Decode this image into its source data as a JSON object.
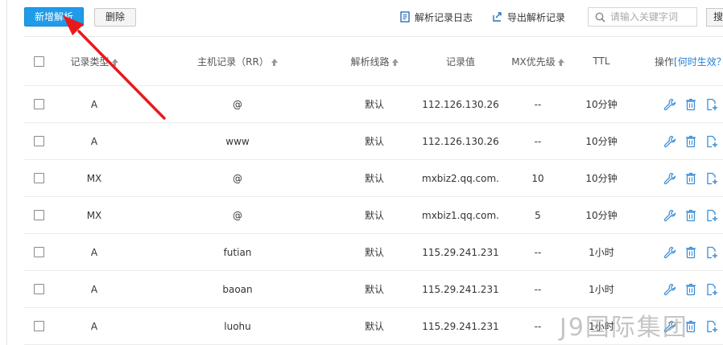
{
  "toolbar": {
    "add_label": "新增解析",
    "delete_label": "删除",
    "log_label": "解析记录日志",
    "export_label": "导出解析记录",
    "search_placeholder": "请输入关键字词",
    "search_btn": "搜"
  },
  "table": {
    "headers": {
      "type": "记录类型",
      "host": "主机记录（RR）",
      "line": "解析线路",
      "value": "记录值",
      "mx": "MX优先级",
      "ttl": "TTL",
      "ops": "操作",
      "ops_link": "[何时生效？"
    },
    "rows": [
      {
        "type": "A",
        "host": "@",
        "line": "默认",
        "value": "112.126.130.26",
        "mx": "--",
        "ttl": "10分钟"
      },
      {
        "type": "A",
        "host": "www",
        "line": "默认",
        "value": "112.126.130.26",
        "mx": "--",
        "ttl": "10分钟"
      },
      {
        "type": "MX",
        "host": "@",
        "line": "默认",
        "value": "mxbiz2.qq.com.",
        "mx": "10",
        "ttl": "10分钟"
      },
      {
        "type": "MX",
        "host": "@",
        "line": "默认",
        "value": "mxbiz1.qq.com.",
        "mx": "5",
        "ttl": "10分钟"
      },
      {
        "type": "A",
        "host": "futian",
        "line": "默认",
        "value": "115.29.241.231",
        "mx": "--",
        "ttl": "1小时"
      },
      {
        "type": "A",
        "host": "baoan",
        "line": "默认",
        "value": "115.29.241.231",
        "mx": "--",
        "ttl": "1小时"
      },
      {
        "type": "A",
        "host": "luohu",
        "line": "默认",
        "value": "115.29.241.231",
        "mx": "--",
        "ttl": "1小时"
      }
    ]
  },
  "watermark": "J9国际集团",
  "colors": {
    "primary": "#1f9bea",
    "icon": "#3b8fd8",
    "annotation": "#e8191b"
  }
}
